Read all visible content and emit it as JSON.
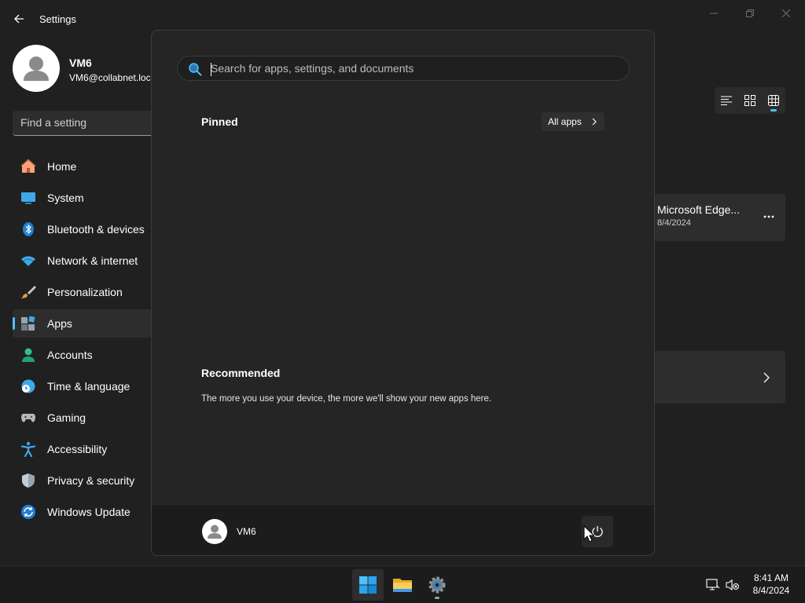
{
  "settings_window": {
    "title": "Settings",
    "profile": {
      "name": "VM6",
      "email": "VM6@collabnet.loc"
    },
    "search_placeholder": "Find a setting",
    "nav_items": [
      {
        "label": "Home",
        "icon": "home-icon"
      },
      {
        "label": "System",
        "icon": "system-icon"
      },
      {
        "label": "Bluetooth & devices",
        "icon": "bluetooth-icon"
      },
      {
        "label": "Network & internet",
        "icon": "network-icon"
      },
      {
        "label": "Personalization",
        "icon": "brush-icon"
      },
      {
        "label": "Apps",
        "icon": "apps-icon",
        "active": true
      },
      {
        "label": "Accounts",
        "icon": "accounts-icon"
      },
      {
        "label": "Time & language",
        "icon": "time-language-icon"
      },
      {
        "label": "Gaming",
        "icon": "gamepad-icon"
      },
      {
        "label": "Accessibility",
        "icon": "accessibility-icon"
      },
      {
        "label": "Privacy & security",
        "icon": "shield-icon"
      },
      {
        "label": "Windows Update",
        "icon": "update-icon"
      }
    ],
    "app_card": {
      "name": "Microsoft Edge...",
      "date": "8/4/2024"
    }
  },
  "start_menu": {
    "search_placeholder": "Search for apps, settings, and documents",
    "pinned_title": "Pinned",
    "all_apps_label": "All apps",
    "recommended_title": "Recommended",
    "recommended_text": "The more you use your device, the more we'll show your new apps here.",
    "user_name": "VM6"
  },
  "taskbar": {
    "time": "8:41 AM",
    "date": "8/4/2024"
  },
  "colors": {
    "accent": "#4cc2ff",
    "window_bg": "#202020",
    "start_bg": "#252525"
  }
}
